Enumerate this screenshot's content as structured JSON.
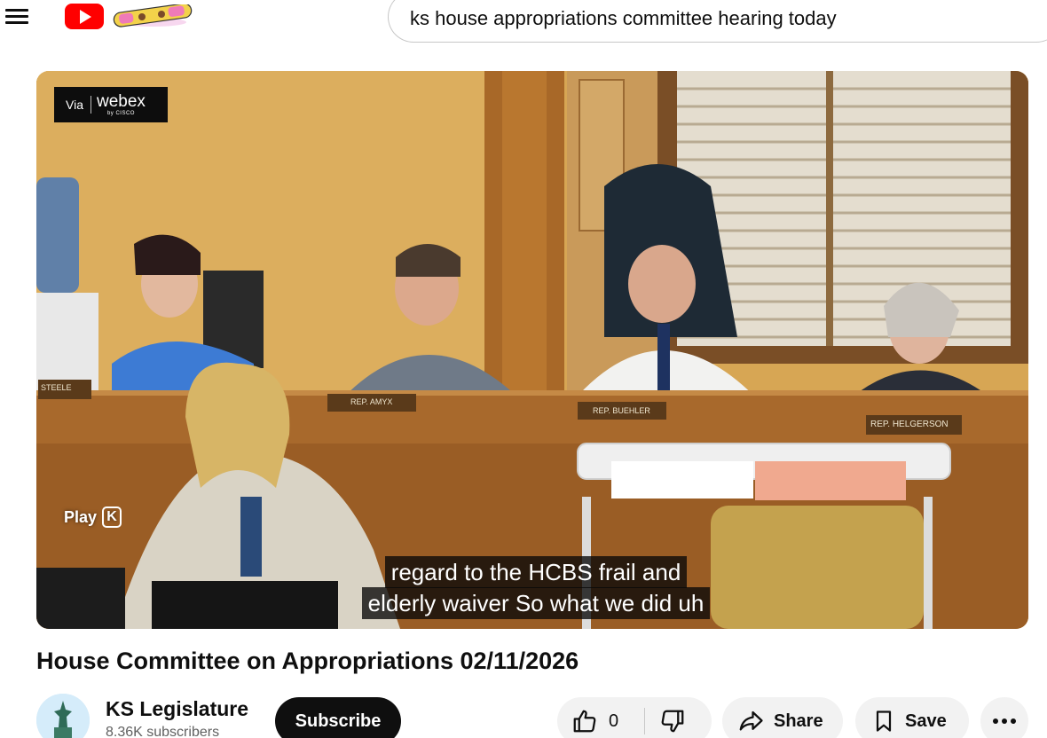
{
  "masthead": {
    "menu_icon": "hamburger-menu-icon",
    "logo_icon": "youtube-logo-icon",
    "logo_color": "#ff0000",
    "doodle_icon": "hoverboard-doodle-icon",
    "search_query": "ks house appropriations committee hearing today"
  },
  "player": {
    "overlay_via": "Via",
    "overlay_brand": "webex",
    "overlay_brand_sub": "by CISCO",
    "nameplates": [
      "STEELE",
      "REP. AMYX",
      "REP. BUEHLER",
      "REP. HELGERSON"
    ],
    "play_hint_label": "Play",
    "play_hint_key": "K",
    "caption_line1": "regard to the HCBS frail and",
    "caption_line2": "elderly waiver So what we did uh"
  },
  "video": {
    "title": "House Committee on Appropriations 02/11/2026"
  },
  "channel": {
    "avatar_icon": "capitol-statue-avatar-icon",
    "name": "KS Legislature",
    "subscribers": "8.36K subscribers",
    "subscribe_label": "Subscribe"
  },
  "actions": {
    "like_icon": "thumbs-up-icon",
    "like_count": "0",
    "dislike_icon": "thumbs-down-icon",
    "share_icon": "share-arrow-icon",
    "share_label": "Share",
    "save_icon": "bookmark-icon",
    "save_label": "Save",
    "more_icon": "more-horizontal-icon"
  }
}
